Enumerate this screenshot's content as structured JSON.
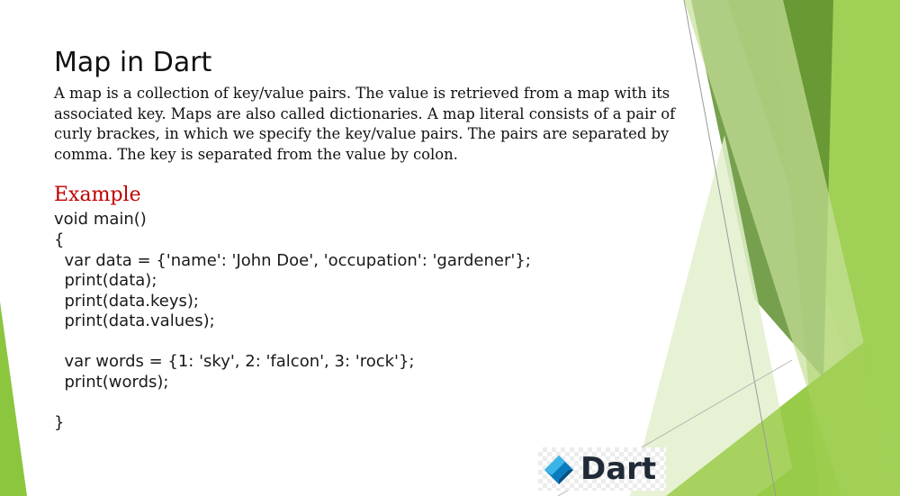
{
  "slide": {
    "title": "Map in Dart",
    "description_lines": [
      "A map is a collection of key/value pairs. The value is retrieved from a map with its",
      "associated key. Maps are also called dictionaries. A map literal consists of a pair of",
      "curly brackes, in which we specify the key/value pairs. The pairs are separated by",
      "comma. The key is separated from the value by colon."
    ],
    "example_heading": "Example",
    "code_lines": [
      "void main()",
      "{",
      "  var data = {'name': 'John Doe', 'occupation': 'gardener'};",
      "  print(data);",
      "  print(data.keys);",
      "  print(data.values);",
      "",
      "  var words = {1: 'sky', 2: 'falcon', 3: 'rock'};",
      "  print(words);",
      "",
      "}"
    ],
    "logo": {
      "text": "Dart",
      "icon": "dart-logo-icon"
    }
  },
  "colors": {
    "accent_green": "#8cc63f",
    "dark_green": "#5e8f2e",
    "example_red": "#c00000",
    "text": "#111111"
  }
}
